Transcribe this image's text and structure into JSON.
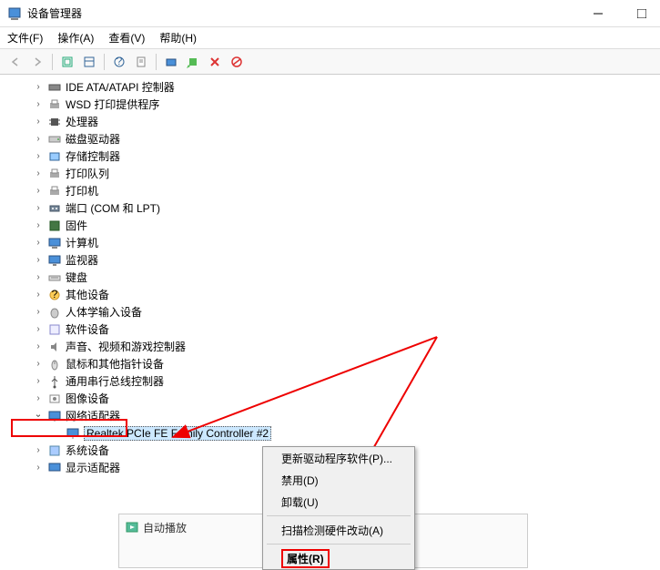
{
  "window": {
    "title": "设备管理器"
  },
  "menu": {
    "file": "文件(F)",
    "action": "操作(A)",
    "view": "查看(V)",
    "help": "帮助(H)"
  },
  "tree": {
    "items": [
      {
        "label": "IDE ATA/ATAPI 控制器",
        "icon": "ide"
      },
      {
        "label": "WSD 打印提供程序",
        "icon": "printer"
      },
      {
        "label": "处理器",
        "icon": "cpu"
      },
      {
        "label": "磁盘驱动器",
        "icon": "disk"
      },
      {
        "label": "存储控制器",
        "icon": "storage"
      },
      {
        "label": "打印队列",
        "icon": "printer"
      },
      {
        "label": "打印机",
        "icon": "printer"
      },
      {
        "label": "端口 (COM 和 LPT)",
        "icon": "port"
      },
      {
        "label": "固件",
        "icon": "firmware"
      },
      {
        "label": "计算机",
        "icon": "computer"
      },
      {
        "label": "监视器",
        "icon": "monitor"
      },
      {
        "label": "键盘",
        "icon": "keyboard"
      },
      {
        "label": "其他设备",
        "icon": "other"
      },
      {
        "label": "人体学输入设备",
        "icon": "hid"
      },
      {
        "label": "软件设备",
        "icon": "software"
      },
      {
        "label": "声音、视频和游戏控制器",
        "icon": "audio"
      },
      {
        "label": "鼠标和其他指针设备",
        "icon": "mouse"
      },
      {
        "label": "通用串行总线控制器",
        "icon": "usb"
      },
      {
        "label": "图像设备",
        "icon": "image"
      }
    ],
    "network_adapter": {
      "label": "网络适配器",
      "child": "Realtek PCIe FE Family Controller #2"
    },
    "after": [
      {
        "label": "系统设备",
        "icon": "system"
      },
      {
        "label": "显示适配器",
        "icon": "display"
      }
    ]
  },
  "context_menu": {
    "update_driver": "更新驱动程序软件(P)...",
    "disable": "禁用(D)",
    "uninstall": "卸载(U)",
    "scan": "扫描检测硬件改动(A)",
    "properties": "属性(R)"
  },
  "bottom_strip": {
    "label": "自动播放"
  }
}
